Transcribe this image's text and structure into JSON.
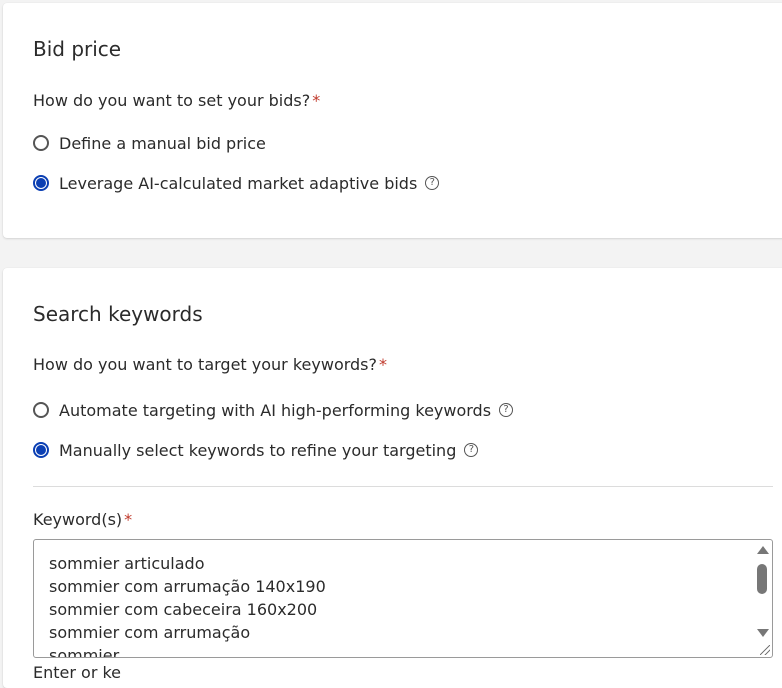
{
  "bid_price": {
    "title": "Bid price",
    "question": "How do you want to set your bids?",
    "required_mark": "*",
    "options": [
      {
        "label": "Define a manual bid price",
        "selected": false,
        "help": false
      },
      {
        "label": "Leverage AI-calculated market adaptive bids",
        "selected": true,
        "help": true
      }
    ]
  },
  "search_keywords": {
    "title": "Search keywords",
    "question": "How do you want to target your keywords?",
    "required_mark": "*",
    "options": [
      {
        "label": "Automate targeting with AI high-performing keywords",
        "selected": false,
        "help": true
      },
      {
        "label": "Manually select keywords to refine your targeting",
        "selected": true,
        "help": true
      }
    ],
    "keywords_label": "Keyword(s)",
    "keywords_required_mark": "*",
    "keywords": [
      "sommier articulado",
      "sommier com arrumação 140x190",
      "sommier com cabeceira 160x200",
      "sommier com arrumação",
      "sommier"
    ],
    "cut_text": "Enter or ke"
  },
  "colors": {
    "accent": "#0b3fb3",
    "required": "#c0392b"
  },
  "icons": {
    "help": "question-circle-icon",
    "radio_selected": "radio-selected-icon",
    "radio_empty": "radio-empty-icon"
  }
}
